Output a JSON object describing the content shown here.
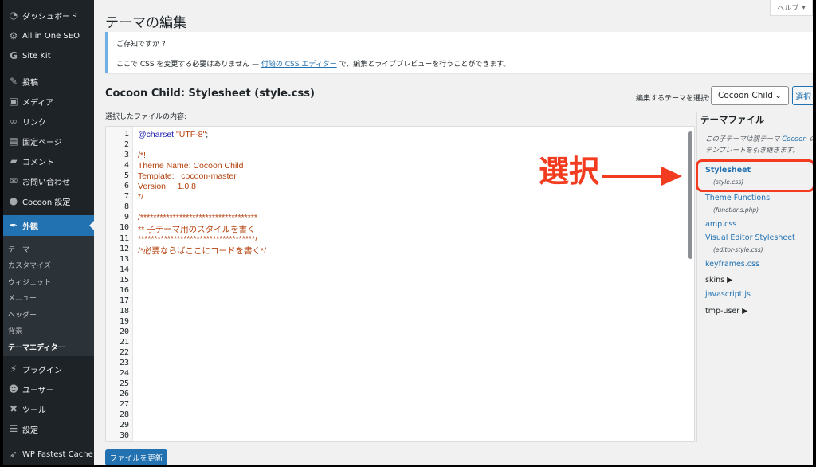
{
  "sidebar": {
    "items": [
      {
        "label": "ダッシュボード",
        "icon": "dashboard-icon"
      },
      {
        "label": "All in One SEO",
        "icon": "gear-icon"
      },
      {
        "label": "Site Kit",
        "icon": "g-icon"
      },
      {
        "label": "投稿",
        "icon": "pin-icon"
      },
      {
        "label": "メディア",
        "icon": "media-icon"
      },
      {
        "label": "リンク",
        "icon": "link-icon"
      },
      {
        "label": "固定ページ",
        "icon": "page-icon"
      },
      {
        "label": "コメント",
        "icon": "comment-icon"
      },
      {
        "label": "お問い合わせ",
        "icon": "mail-icon"
      },
      {
        "label": "Cocoon 設定",
        "icon": "circle-icon"
      },
      {
        "label": "外観",
        "icon": "brush-icon"
      },
      {
        "label": "プラグイン",
        "icon": "plug-icon"
      },
      {
        "label": "ユーザー",
        "icon": "user-icon"
      },
      {
        "label": "ツール",
        "icon": "wrench-icon"
      },
      {
        "label": "設定",
        "icon": "settings-icon"
      },
      {
        "label": "WP Fastest Cache",
        "icon": "cheetah-icon"
      }
    ],
    "submenu": [
      "テーマ",
      "カスタマイズ",
      "ウィジェット",
      "メニュー",
      "ヘッダー",
      "背景",
      "テーマエディター"
    ]
  },
  "header": {
    "title": "テーマの編集",
    "help": "ヘルプ"
  },
  "notice": {
    "title": "ご存知ですか ?",
    "body_before": "ここで CSS を変更する必要はありません — ",
    "link": "付随の CSS エディター",
    "body_after": " で、編集とライブプレビューを行うことができます。"
  },
  "editor": {
    "file_heading": "Cocoon Child: Stylesheet (style.css)",
    "select_label": "編集するテーマを選択:",
    "selected_theme": "Cocoon Child",
    "select_button": "選択",
    "content_label": "選択したファイルの内容:",
    "code_lines": [
      "@charset \"UTF-8\";",
      "",
      "/*!",
      "Theme Name: Cocoon Child",
      "Template:   cocoon-master",
      "Version:    1.0.8",
      "*/",
      "",
      "/************************************",
      "** 子テーマ用のスタイルを書く",
      "************************************/",
      "/*必要ならばここにコードを書く*/"
    ],
    "line_count": 30,
    "update_button": "ファイルを更新"
  },
  "files": {
    "title": "テーマファイル",
    "note_before": "この子テーマは親テーマ ",
    "note_link": "Cocoon",
    "note_after": " のテンプレートを引き継ぎます。",
    "stylesheet": "Stylesheet",
    "stylesheet_sub": "(style.css)",
    "functions": "Theme Functions",
    "functions_sub": "(functions.php)",
    "amp": "amp.css",
    "visual": "Visual Editor Stylesheet",
    "visual_sub": "(editor-style.css)",
    "keyframes": "keyframes.css",
    "skins": "skins ▶",
    "javascript": "javascript.js",
    "tmpuser": "tmp-user ▶"
  },
  "annotation": {
    "text": "選択",
    "color": "#f23b1f"
  }
}
